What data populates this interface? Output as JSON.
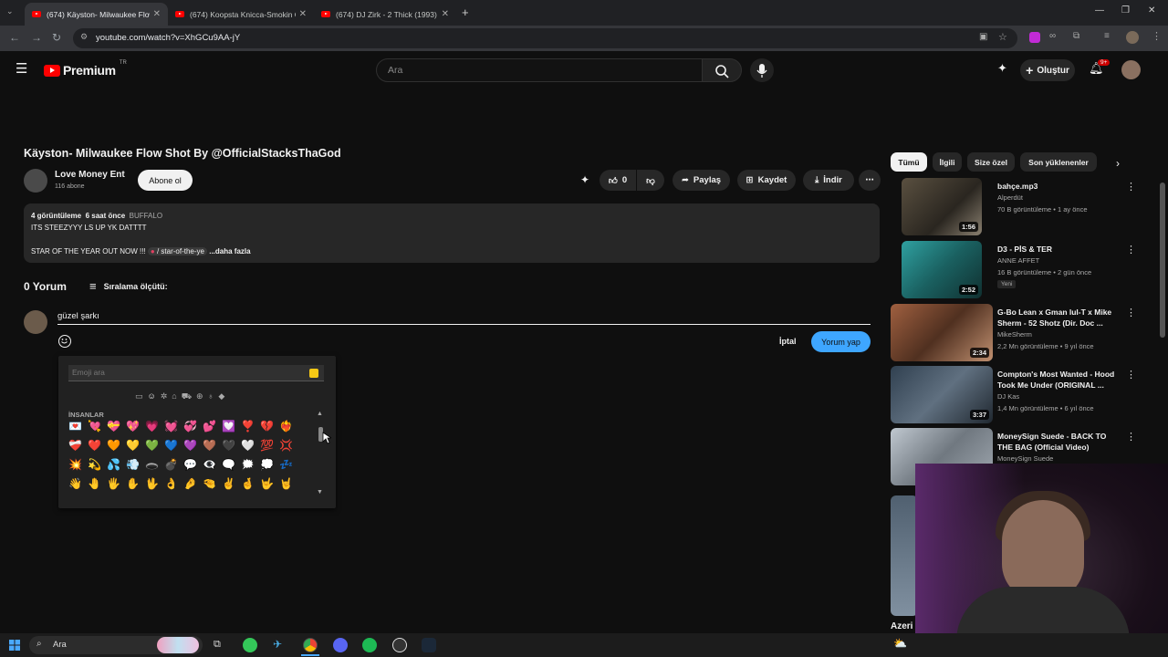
{
  "browser": {
    "tabs": [
      {
        "title": "(674) Käyston- Milwaukee Flow",
        "active": true
      },
      {
        "title": "(674) Koopsta Knicca-Smokin O",
        "active": false
      },
      {
        "title": "(674) DJ Zirk - 2 Thick (1993) -",
        "active": false
      }
    ],
    "url": "youtube.com/watch?v=XhGCu9AA-jY"
  },
  "masthead": {
    "brand": "Premium",
    "region": "TR",
    "search_placeholder": "Ara",
    "create_label": "Oluştur",
    "notif_count": "9+"
  },
  "video": {
    "title": "Käyston- Milwaukee Flow Shot By @OfficialStacksThaGod",
    "channel": "Love Money Ent",
    "subscribers": "116 abone",
    "subscribe_label": "Abone ol",
    "likes": "0",
    "share_label": "Paylaş",
    "save_label": "Kaydet",
    "download_label": "İndir",
    "views": "4 görüntüleme",
    "age": "6 saat önce",
    "tag": "BUFFALO",
    "desc_line1": "ITS STEEZYYY LS UP YK DATTTT",
    "desc_line2": "STAR OF THE YEAR OUT NOW !!!",
    "desc_link": "/ star-of-the-ye",
    "more_label": "...daha fazla"
  },
  "comments": {
    "count_label": "0 Yorum",
    "sort_label": "Sıralama ölçütü:",
    "draft": "güzel şarkı",
    "cancel_label": "İptal",
    "post_label": "Yorum yap"
  },
  "emoji_picker": {
    "search_placeholder": "Emoji ara",
    "section_label": "İNSANLAR",
    "category_icons": [
      "▭",
      "☺",
      "✲",
      "⌂",
      "⛟",
      "⊕",
      "♁",
      "◆"
    ],
    "emojis": [
      "💌",
      "💘",
      "💝",
      "💖",
      "💗",
      "💓",
      "💞",
      "💕",
      "💟",
      "❣️",
      "💔",
      "❤️‍🔥",
      "❤️‍🩹",
      "❤️",
      "🧡",
      "💛",
      "💚",
      "💙",
      "💜",
      "🤎",
      "🖤",
      "🤍",
      "💯",
      "💢",
      "💥",
      "💫",
      "💦",
      "💨",
      "🕳️",
      "💣",
      "💬",
      "👁️‍🗨️",
      "🗨️",
      "🗯️",
      "💭",
      "💤",
      "👋",
      "🤚",
      "🖐️",
      "✋",
      "🖖",
      "👌",
      "🤌",
      "🤏",
      "✌️",
      "🤞",
      "🤟",
      "🤘"
    ]
  },
  "sidebar": {
    "chips": [
      "Tümü",
      "İlgili",
      "Size özel",
      "Son yüklenenler"
    ],
    "recommendations": [
      {
        "title": "bahçe.mp3",
        "channel": "Alperdüt",
        "meta": "70 B görüntüleme • 1 ay önce",
        "duration": "1:56",
        "badge": ""
      },
      {
        "title": "D3 - PİS & TER",
        "channel": "ANNE AFFET",
        "meta": "16 B görüntüleme • 2 gün önce",
        "duration": "2:52",
        "badge": "Yeni"
      },
      {
        "title": "G-Bo Lean x Gman lul-T x Mike Sherm - 52 Shotz (Dir. Doc ...",
        "channel": "MikeSherm",
        "meta": "2,2 Mn görüntüleme • 9 yıl önce",
        "duration": "2:34",
        "badge": ""
      },
      {
        "title": "Compton's Most Wanted - Hood Took Me Under (ORIGINAL ...",
        "channel": "DJ Kas",
        "meta": "1,4 Mn görüntüleme • 6 yıl önce",
        "duration": "3:37",
        "badge": ""
      },
      {
        "title": "MoneySign Suede - BACK TO THE BAG (Official Video)",
        "channel": "MoneySign Suede",
        "meta": "",
        "duration": "",
        "badge": ""
      }
    ],
    "partial_title": "Azeri"
  },
  "taskbar": {
    "search_placeholder": "Ara"
  },
  "colors": {
    "accent": "#3ea6ff",
    "youtube_red": "#ff0000",
    "background": "#0f0f0f"
  }
}
